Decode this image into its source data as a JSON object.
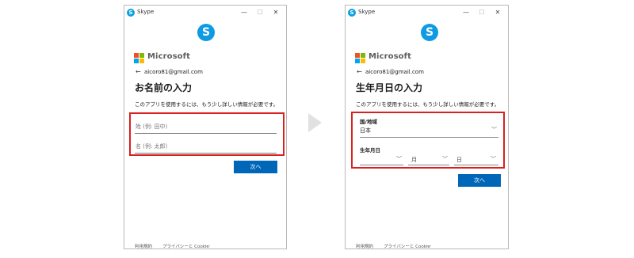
{
  "window": {
    "app_title": "Skype",
    "minimize": "—",
    "maximize": "☐",
    "close": "✕",
    "skype_glyph": "S"
  },
  "brand": {
    "microsoft": "Microsoft"
  },
  "account": {
    "email": "aicoro81@gmail.com",
    "back_glyph": "←"
  },
  "name_form": {
    "heading": "お名前の入力",
    "description": "このアプリを使用するには、もう少し詳しい情報が必要です。",
    "last_name_placeholder": "姓 (例: 田中)",
    "first_name_placeholder": "名 (例: 太郎)",
    "next_label": "次へ"
  },
  "birth_form": {
    "heading": "生年月日の入力",
    "description": "このアプリを使用するには、もう少し詳しい情報が必要です。",
    "country_label": "国/地域",
    "country_value": "日本",
    "birthdate_label": "生年月日",
    "month_placeholder": "月",
    "day_placeholder": "日",
    "next_label": "次へ"
  },
  "footer": {
    "terms": "利用規約",
    "privacy": "プライバシーと Cookie",
    "more": "..."
  },
  "icons": {
    "chevron": "﹀"
  },
  "colors": {
    "highlight_border": "#d9201f",
    "primary_button": "#0067b8",
    "skype_blue": "#0f9ae4"
  }
}
